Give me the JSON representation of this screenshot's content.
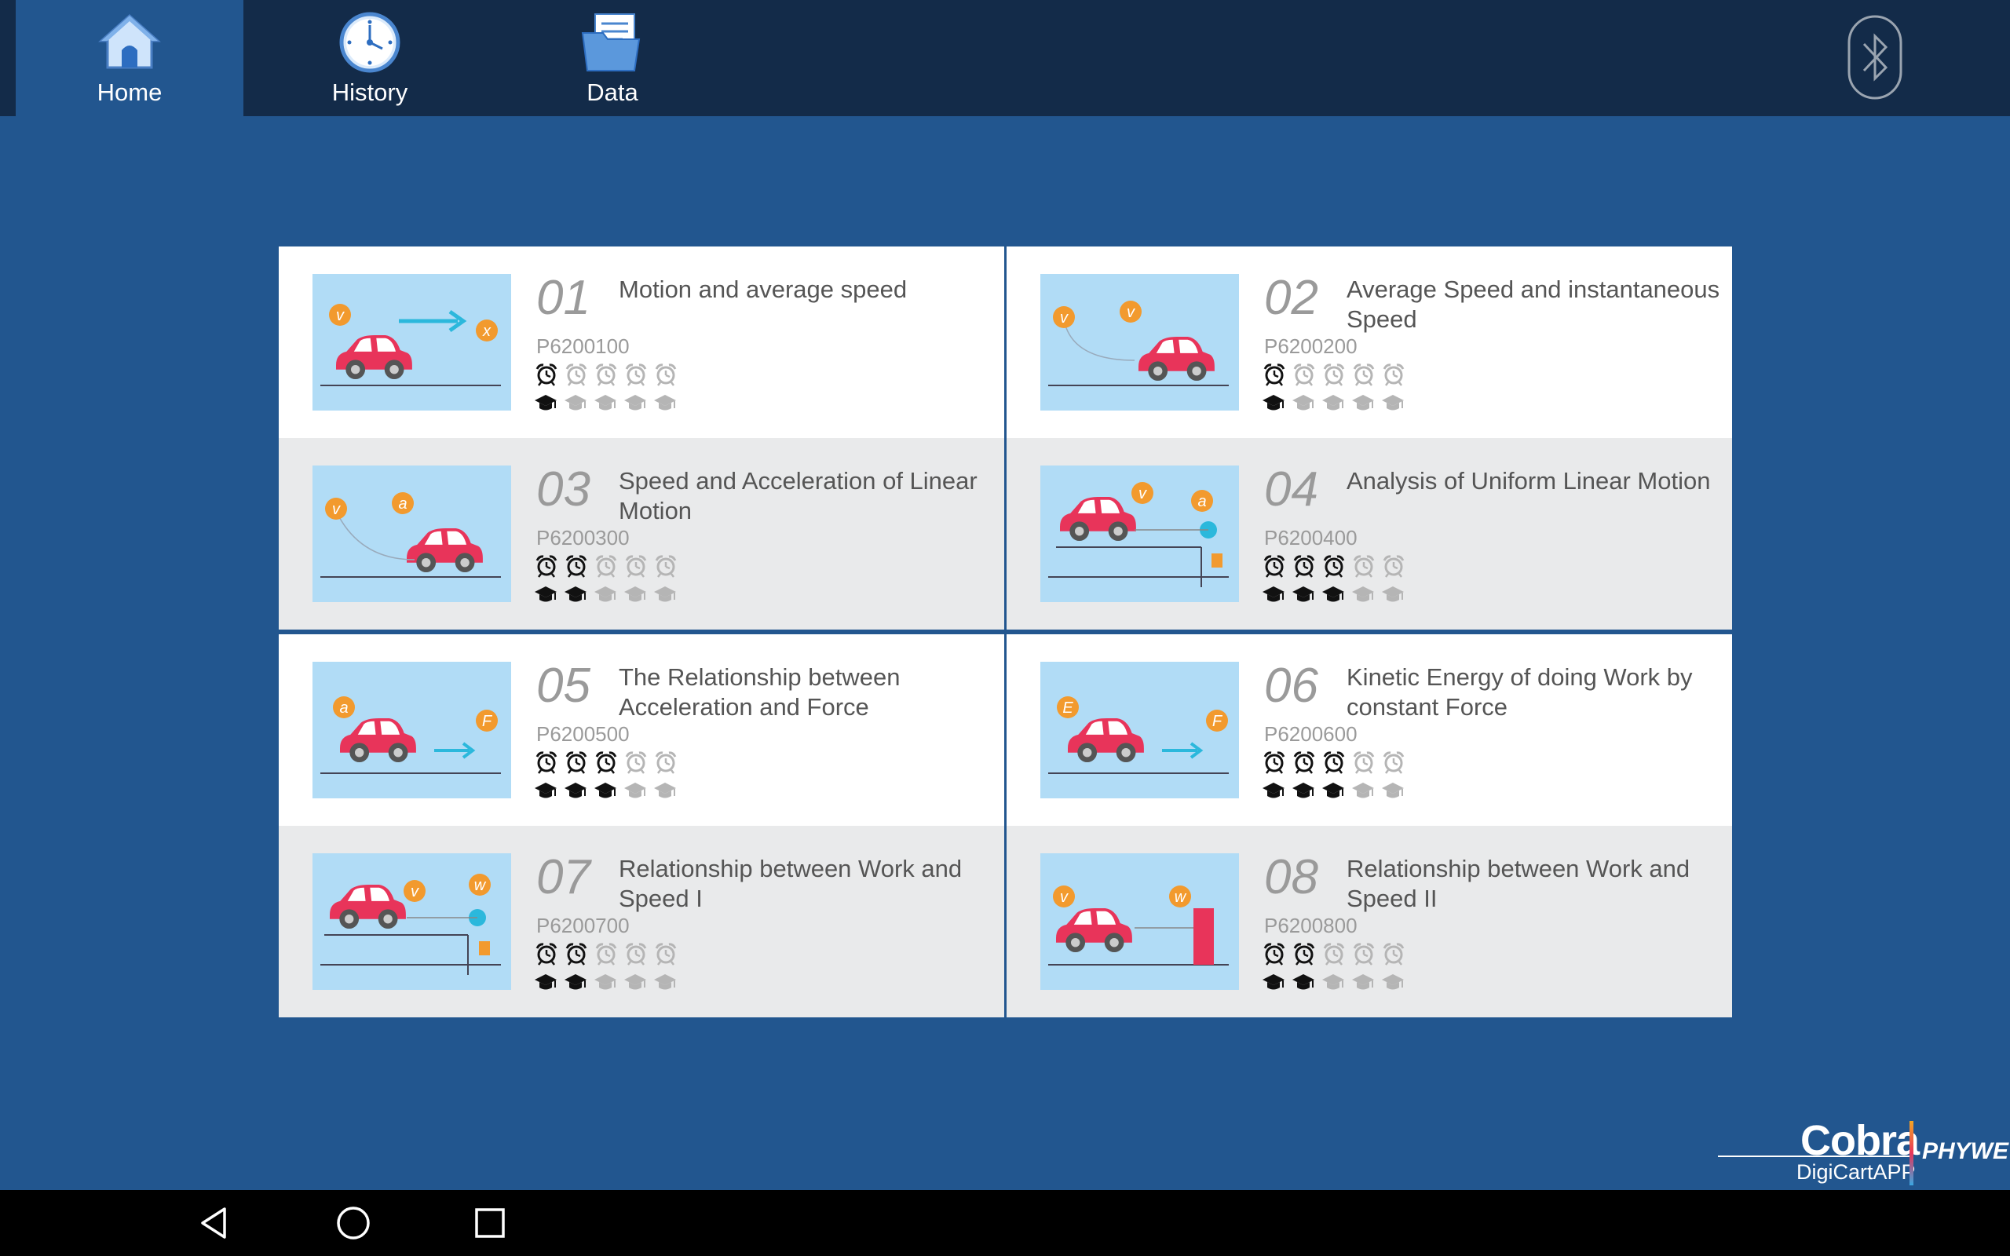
{
  "nav": {
    "tabs": [
      {
        "label": "Home",
        "icon": "home-icon",
        "active": true
      },
      {
        "label": "History",
        "icon": "clock-icon",
        "active": false
      },
      {
        "label": "Data",
        "icon": "folder-icon",
        "active": false
      }
    ],
    "bluetooth_icon": "bluetooth-icon"
  },
  "experiments": [
    {
      "number": "01",
      "title": "Motion and average speed",
      "code": "P6200100",
      "difficulty": 1,
      "level": 1
    },
    {
      "number": "02",
      "title": "Average Speed and instantaneous Speed",
      "code": "P6200200",
      "difficulty": 1,
      "level": 1
    },
    {
      "number": "03",
      "title": "Speed and Acceleration of Linear Motion",
      "code": "P6200300",
      "difficulty": 2,
      "level": 2
    },
    {
      "number": "04",
      "title": "Analysis of Uniform Linear Motion",
      "code": "P6200400",
      "difficulty": 3,
      "level": 3
    },
    {
      "number": "05",
      "title": "The Relationship between Acceleration and Force",
      "code": "P6200500",
      "difficulty": 3,
      "level": 3
    },
    {
      "number": "06",
      "title": "Kinetic Energy of doing Work by constant Force",
      "code": "P6200600",
      "difficulty": 3,
      "level": 3
    },
    {
      "number": "07",
      "title": "Relationship between Work and Speed I",
      "code": "P6200700",
      "difficulty": 2,
      "level": 2
    },
    {
      "number": "08",
      "title": "Relationship between Work and Speed II",
      "code": "P6200800",
      "difficulty": 2,
      "level": 2
    }
  ],
  "rating_max": 5,
  "thumb_badges": [
    [
      "v",
      "x"
    ],
    [
      "v",
      "v"
    ],
    [
      "v",
      "a"
    ],
    [
      "v",
      "a"
    ],
    [
      "a",
      "F"
    ],
    [
      "E",
      "F"
    ],
    [
      "v",
      "w"
    ],
    [
      "v",
      "w"
    ]
  ],
  "logo": {
    "brand": "Cobra",
    "product": "DigiCartAPP",
    "company": "PHYWE"
  },
  "system_nav": {
    "back_icon": "back-icon",
    "home_icon": "home-circle-icon",
    "recents_icon": "recents-icon"
  },
  "colors": {
    "topbar": "#132b49",
    "background": "#22568f",
    "thumb_bg": "#b1dcf6",
    "car": "#e8345a",
    "badge": "#f29a2e",
    "arrow": "#2bb8dc"
  }
}
